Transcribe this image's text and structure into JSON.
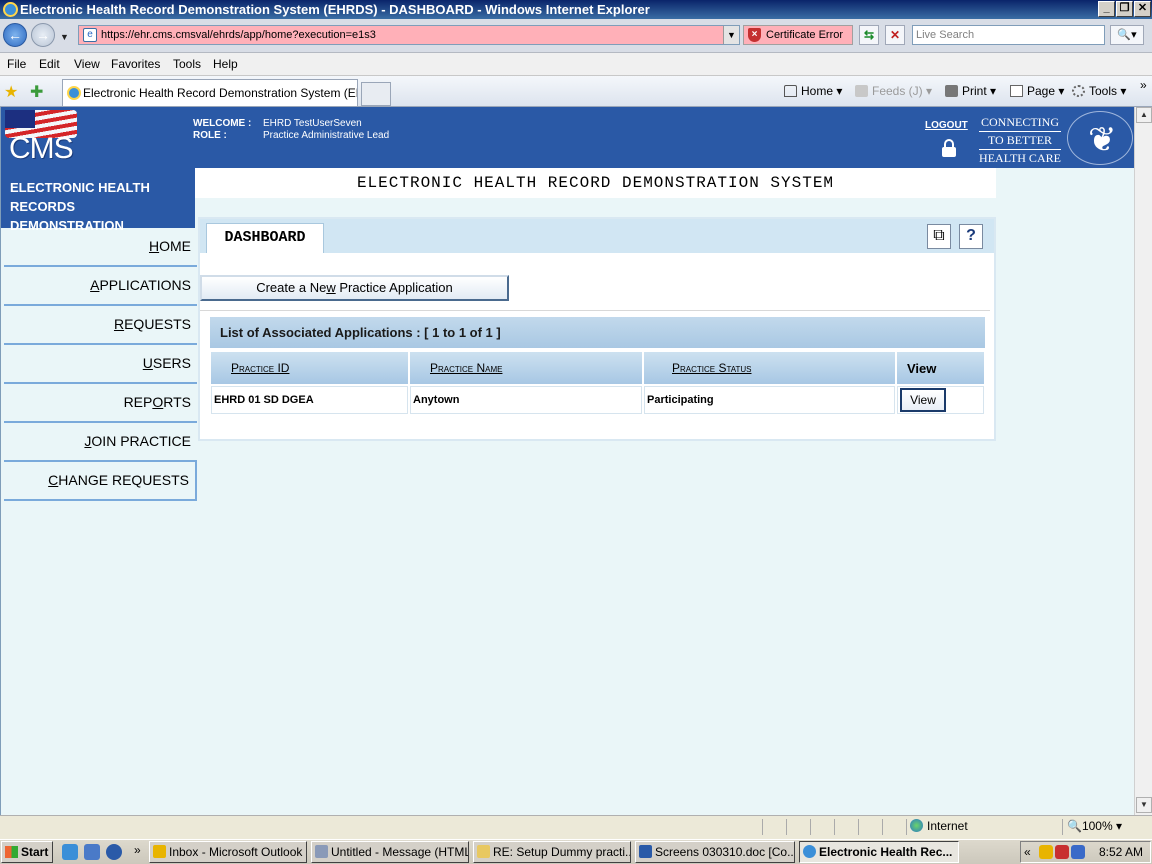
{
  "window": {
    "title": "Electronic Health Record Demonstration System (EHRDS) - DASHBOARD - Windows Internet Explorer"
  },
  "browser": {
    "url": "https://ehr.cms.cmsval/ehrds/app/home?execution=e1s3",
    "cert_error": "Certificate Error",
    "search_placeholder": "Live Search",
    "menu": [
      "File",
      "Edit",
      "View",
      "Favorites",
      "Tools",
      "Help"
    ],
    "tab_title": "Electronic Health Record Demonstration System (EHR...",
    "commands": {
      "home": "Home",
      "feeds": "Feeds (J)",
      "print": "Print",
      "page": "Page",
      "tools": "Tools"
    },
    "status": {
      "zone": "Internet",
      "zoom": "100%"
    }
  },
  "header": {
    "logo_text": "CMS",
    "welcome_label": "WELCOME :",
    "welcome_value": "EHRD TestUserSeven",
    "role_label": "ROLE :",
    "role_value": "Practice Administrative Lead",
    "logout": "LOGOUT",
    "tagline": [
      "CONNECTING",
      "TO BETTER",
      "HEALTH CARE"
    ]
  },
  "sidebar": {
    "title_line1": "ELECTRONIC HEALTH RECORDS",
    "title_line2": "DEMONSTRATION",
    "items": [
      {
        "pre": "",
        "u": "H",
        "post": "OME"
      },
      {
        "pre": "",
        "u": "A",
        "post": "PPLICATIONS"
      },
      {
        "pre": "",
        "u": "R",
        "post": "EQUESTS"
      },
      {
        "pre": "",
        "u": "U",
        "post": "SERS"
      },
      {
        "pre": "REP",
        "u": "O",
        "post": "RTS"
      },
      {
        "pre": "",
        "u": "J",
        "post": "OIN PRACTICE"
      },
      {
        "pre": "",
        "u": "C",
        "post": "HANGE REQUESTS"
      }
    ]
  },
  "main": {
    "system_title": "ELECTRONIC HEALTH RECORD DEMONSTRATION SYSTEM",
    "tab_label": "DASHBOARD",
    "create_button_pre": "Create a Ne",
    "create_button_u": "w",
    "create_button_post": " Practice Application",
    "list_title": "List of Associated Applications : [ 1 to 1 of 1 ]",
    "columns": [
      "Practice ID",
      "Practice Name",
      "Practice Status",
      "View"
    ],
    "rows": [
      {
        "id": "EHRD 01 SD DGEA",
        "name": "Anytown",
        "status": "Participating",
        "view": "View"
      }
    ]
  },
  "taskbar": {
    "start": "Start",
    "buttons": [
      "Inbox - Microsoft Outlook",
      "Untitled - Message (HTML)",
      "RE: Setup Dummy practi...",
      "Screens 030310.doc [Co...",
      "Electronic Health Rec..."
    ],
    "clock": "8:52 AM"
  },
  "colors": {
    "cms_blue": "#2a59a6",
    "page_bg": "#eaf6f8",
    "nav_border": "#7aaadb"
  }
}
